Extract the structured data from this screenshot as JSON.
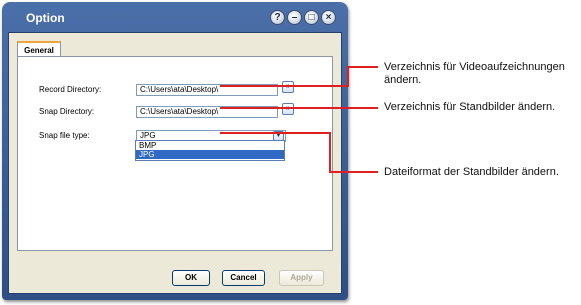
{
  "window": {
    "title": "Option",
    "help_label": "?",
    "minimize_label": "–",
    "maximize_label": "□",
    "close_label": "×"
  },
  "tabs": [
    {
      "label": "General",
      "active": true
    }
  ],
  "form": {
    "record_directory": {
      "label": "Record Directory:",
      "value": "C:\\Users\\ata\\Desktop\\",
      "browse_label": "»"
    },
    "snap_directory": {
      "label": "Snap Directory:",
      "value": "C:\\Users\\ata\\Desktop\\",
      "browse_label": "»"
    },
    "snap_file_type": {
      "label": "Snap file type:",
      "value": "JPG",
      "dropdown_icon": "chevron-down-icon",
      "options": [
        "BMP",
        "JPG"
      ],
      "selected_option": "JPG"
    }
  },
  "buttons": {
    "ok": "OK",
    "cancel": "Cancel",
    "apply": "Apply"
  },
  "annotations": {
    "record": "Verzeichnis für Videoaufzeichnungen ändern.",
    "snap": "Verzeichnis für Standbilder ändern.",
    "filetype": "Dateiformat der Standbilder ändern."
  },
  "colors": {
    "titlebar": "#3e6199",
    "callout_line": "#e02020",
    "selection": "#316ac5"
  }
}
